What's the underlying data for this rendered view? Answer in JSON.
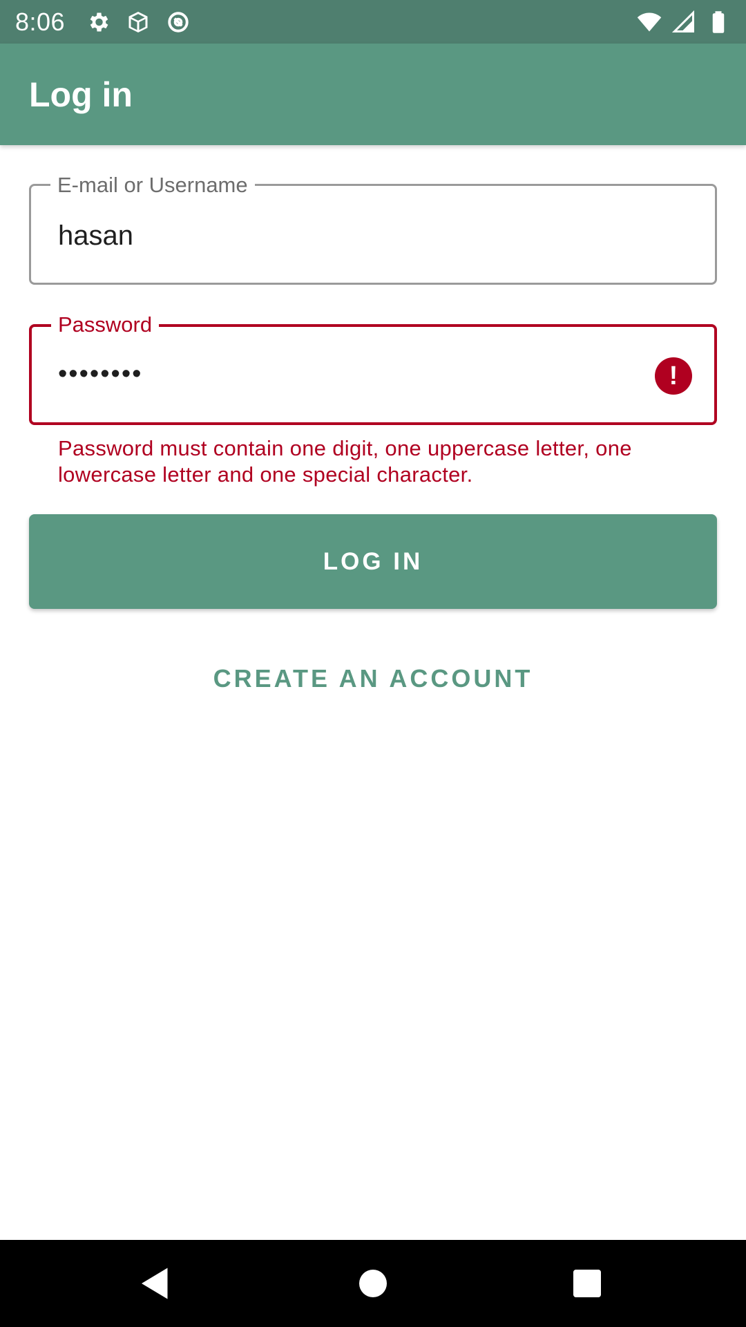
{
  "status_bar": {
    "time": "8:06",
    "left_icons": [
      "settings-icon",
      "package-icon",
      "sync-icon"
    ],
    "right_icons": [
      "wifi-icon",
      "signal-icon",
      "battery-icon"
    ]
  },
  "app_bar": {
    "title": "Log in"
  },
  "form": {
    "username": {
      "label": "E-mail or Username",
      "value": "hasan"
    },
    "password": {
      "label": "Password",
      "value": "••••••••",
      "error_icon": "error-icon",
      "error_text": "Password must contain one digit, one uppercase letter, one lowercase letter and one special character."
    },
    "login_button_label": "LOG IN",
    "create_account_label": "CREATE AN ACCOUNT"
  },
  "colors": {
    "status_bar": "#4f7f6f",
    "primary": "#5a9882",
    "error": "#b00020"
  },
  "nav_bar": {
    "buttons": [
      "back-icon",
      "home-icon",
      "recents-icon"
    ]
  }
}
